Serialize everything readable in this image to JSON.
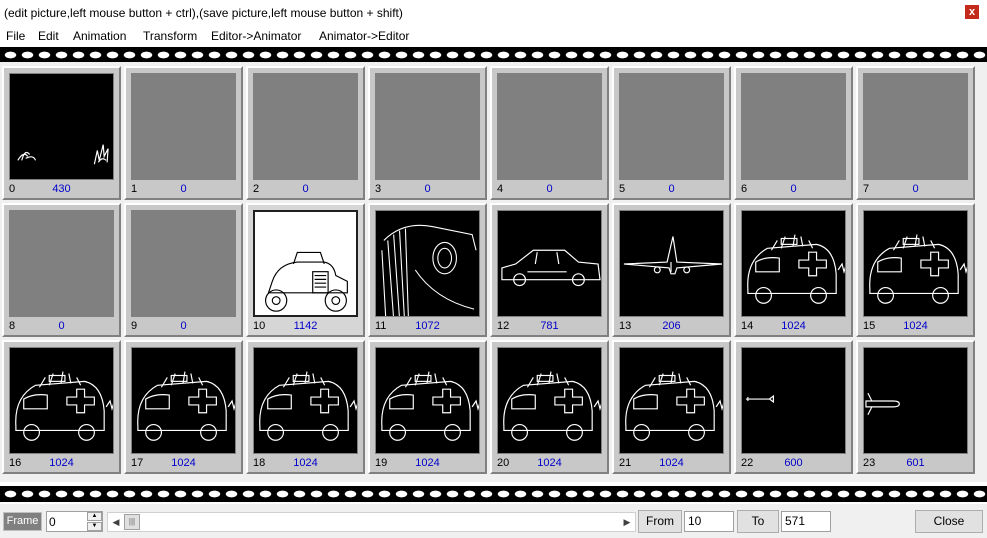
{
  "window": {
    "title": "(edit picture,left mouse button + ctrl),(save picture,left mouse button + shift)",
    "close_glyph": "x"
  },
  "menu": {
    "file": "File",
    "edit": "Edit",
    "animation": "Animation",
    "transform": "Transform",
    "editor_to_animator": "Editor->Animator",
    "animator_to_editor": "Animator->Editor"
  },
  "frames": [
    {
      "index": "0",
      "count": "430",
      "thumb": "black",
      "art": "grass"
    },
    {
      "index": "1",
      "count": "0",
      "thumb": "gray",
      "art": "none"
    },
    {
      "index": "2",
      "count": "0",
      "thumb": "gray",
      "art": "none"
    },
    {
      "index": "3",
      "count": "0",
      "thumb": "gray",
      "art": "none"
    },
    {
      "index": "4",
      "count": "0",
      "thumb": "gray",
      "art": "none"
    },
    {
      "index": "5",
      "count": "0",
      "thumb": "gray",
      "art": "none"
    },
    {
      "index": "6",
      "count": "0",
      "thumb": "gray",
      "art": "none"
    },
    {
      "index": "7",
      "count": "0",
      "thumb": "gray",
      "art": "none"
    },
    {
      "index": "8",
      "count": "0",
      "thumb": "gray",
      "art": "none"
    },
    {
      "index": "9",
      "count": "0",
      "thumb": "gray",
      "art": "none"
    },
    {
      "index": "10",
      "count": "1142",
      "thumb": "white",
      "art": "hotrod",
      "selected": true
    },
    {
      "index": "11",
      "count": "1072",
      "thumb": "black",
      "art": "grille"
    },
    {
      "index": "12",
      "count": "781",
      "thumb": "black",
      "art": "classic-car"
    },
    {
      "index": "13",
      "count": "206",
      "thumb": "black",
      "art": "airplane"
    },
    {
      "index": "14",
      "count": "1024",
      "thumb": "black",
      "art": "ambulance"
    },
    {
      "index": "15",
      "count": "1024",
      "thumb": "black",
      "art": "ambulance"
    },
    {
      "index": "16",
      "count": "1024",
      "thumb": "black",
      "art": "ambulance"
    },
    {
      "index": "17",
      "count": "1024",
      "thumb": "black",
      "art": "ambulance"
    },
    {
      "index": "18",
      "count": "1024",
      "thumb": "black",
      "art": "ambulance"
    },
    {
      "index": "19",
      "count": "1024",
      "thumb": "black",
      "art": "ambulance"
    },
    {
      "index": "20",
      "count": "1024",
      "thumb": "black",
      "art": "ambulance"
    },
    {
      "index": "21",
      "count": "1024",
      "thumb": "black",
      "art": "ambulance"
    },
    {
      "index": "22",
      "count": "600",
      "thumb": "black",
      "art": "missile-small"
    },
    {
      "index": "23",
      "count": "601",
      "thumb": "black",
      "art": "missile"
    }
  ],
  "bottom": {
    "frame_label": "Frame",
    "frame_value": "0",
    "from_label": "From",
    "from_value": "10",
    "to_label": "To",
    "to_value": "571",
    "close_label": "Close"
  }
}
